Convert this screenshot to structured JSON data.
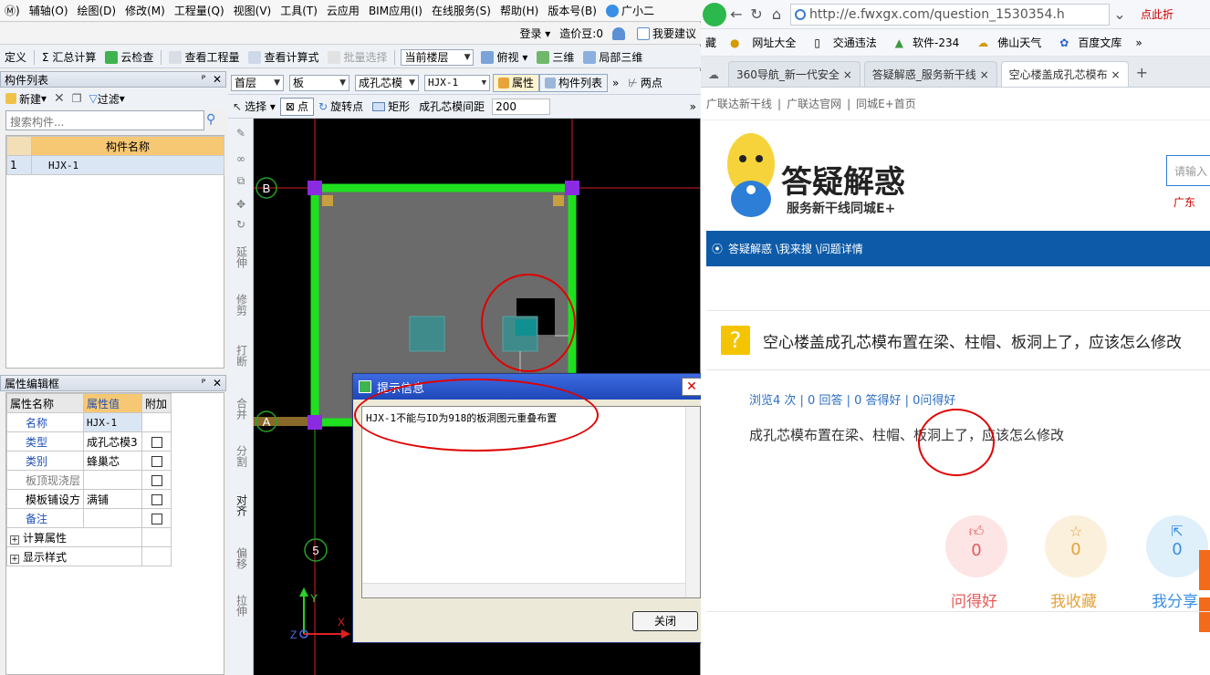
{
  "app": {
    "menu": [
      "Ⓜ)",
      "辅轴(O)",
      "绘图(D)",
      "修改(M)",
      "工程量(Q)",
      "视图(V)",
      "工具(T)",
      "云应用",
      "BIM应用(I)",
      "在线服务(S)",
      "帮助(H)",
      "版本号(B)",
      "广小二"
    ],
    "toolbar_right": {
      "login": "登录",
      "cost_label": "造价豆:0",
      "suggest": "我要建议"
    },
    "toolbar2": [
      "定义",
      "Σ 汇总计算",
      "云检查",
      "查看工程量",
      "查看计算式",
      "批量选择",
      "当前楼层",
      "俯视",
      "三维",
      "局部三维"
    ],
    "floor_bar": {
      "floor": "首层",
      "type": "板",
      "category": "成孔芯模",
      "name": "HJX-1",
      "props": "属性",
      "list": "构件列表",
      "two_points": "两点"
    },
    "draw_bar": {
      "select": "选择",
      "point": "点",
      "rotate_point": "旋转点",
      "rect": "矩形",
      "spacing_label": "成孔芯模间距",
      "spacing_value": "200"
    },
    "component_panel": {
      "title": "构件列表",
      "new": "新建",
      "filter": "过滤",
      "search_placeholder": "搜索构件...",
      "column": "构件名称",
      "rows": [
        {
          "index": "1",
          "name": "HJX-1"
        }
      ]
    },
    "prop_panel": {
      "title": "属性编辑框",
      "headers": [
        "属性名称",
        "属性值",
        "附加"
      ],
      "rows": [
        {
          "name": "名称",
          "value": "HJX-1",
          "check": false
        },
        {
          "name": "类型",
          "value": "成孔芯模3",
          "check": true
        },
        {
          "name": "类别",
          "value": "蜂巢芯",
          "check": true
        },
        {
          "name": "板顶现浇层",
          "value": "",
          "check": true
        },
        {
          "name": "模板铺设方",
          "value": "满铺",
          "check": true
        },
        {
          "name": "备注",
          "value": "",
          "check": true
        }
      ],
      "groups": [
        "计算属性",
        "显示样式"
      ]
    },
    "vtools": [
      "延伸",
      "修剪",
      "打断",
      "合并",
      "分割",
      "对齐",
      "偏移",
      "拉伸"
    ],
    "canvas": {
      "axis_b": "B",
      "axis_a": "A",
      "axis_5": "5",
      "y_label": "Y",
      "x_label": "X",
      "z_label": "Z"
    },
    "dialog": {
      "title": "提示信息",
      "message": "HJX-1不能与ID为918的板洞图元重叠布置",
      "close": "关闭"
    }
  },
  "browser": {
    "url": "http://e.fwxgx.com/question_1530354.h",
    "point_here": "点此折",
    "bookmarks": [
      "藏",
      "网址大全",
      "交通违法",
      "软件-234",
      "佛山天气",
      "百度文库"
    ],
    "tabs": [
      "360导航_新一代安全",
      "答疑解惑_服务新干线",
      "空心楼盖成孔芯模布"
    ],
    "sublinks": [
      "广联达新干线",
      "广联达官网",
      "同城E+首页"
    ],
    "logo_title": "答疑解惑",
    "logo_sub": "服务新干线同城E+",
    "search_placeholder": "请输入",
    "region": "广东",
    "breadcrumb": "答疑解惑 \\我来搜 \\问题详情",
    "question_title": "空心楼盖成孔芯模布置在梁、柱帽、板洞上了，应该怎么修改",
    "stats": "浏览4 次 | 0 回答 | 0 答得好 | 0问得好",
    "question_body": "成孔芯模布置在梁、柱帽、板洞上了，应该怎么修改",
    "actions": [
      {
        "label": "问得好",
        "count": "0",
        "color": "#e85a5a"
      },
      {
        "label": "我收藏",
        "count": "0",
        "color": "#e6a23c"
      },
      {
        "label": "我分享",
        "count": "0",
        "color": "#3a8ee6"
      }
    ]
  }
}
